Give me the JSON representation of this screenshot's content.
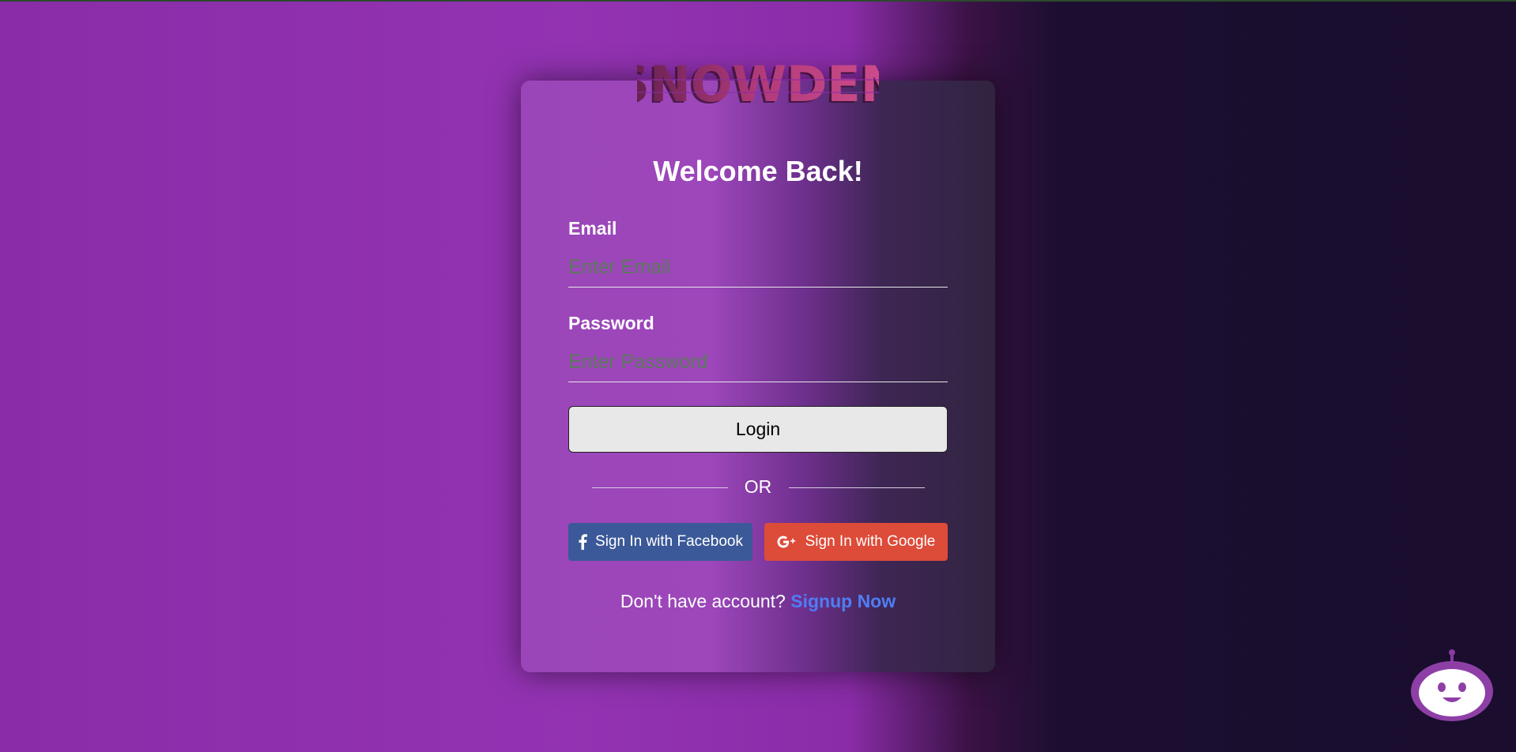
{
  "brand": {
    "logo_text": "SNOWDEN"
  },
  "login": {
    "title": "Welcome Back!",
    "email_label": "Email",
    "email_placeholder": "Enter Email",
    "email_value": "",
    "password_label": "Password",
    "password_placeholder": "Enter Password",
    "password_value": "",
    "login_button": "Login",
    "divider_text": "OR",
    "facebook_button": "Sign In with Facebook",
    "google_button": "Sign In with Google",
    "signup_prompt": "Don't have account?",
    "signup_link": "Signup Now"
  },
  "icons": {
    "facebook": "facebook-icon",
    "google": "google-plus-icon",
    "chatbot": "chatbot-icon"
  },
  "colors": {
    "facebook": "#3b5998",
    "google": "#dd4b39",
    "link": "#4f7df5",
    "background_left": "#8a2ca8",
    "background_right": "#1a0d2e"
  }
}
